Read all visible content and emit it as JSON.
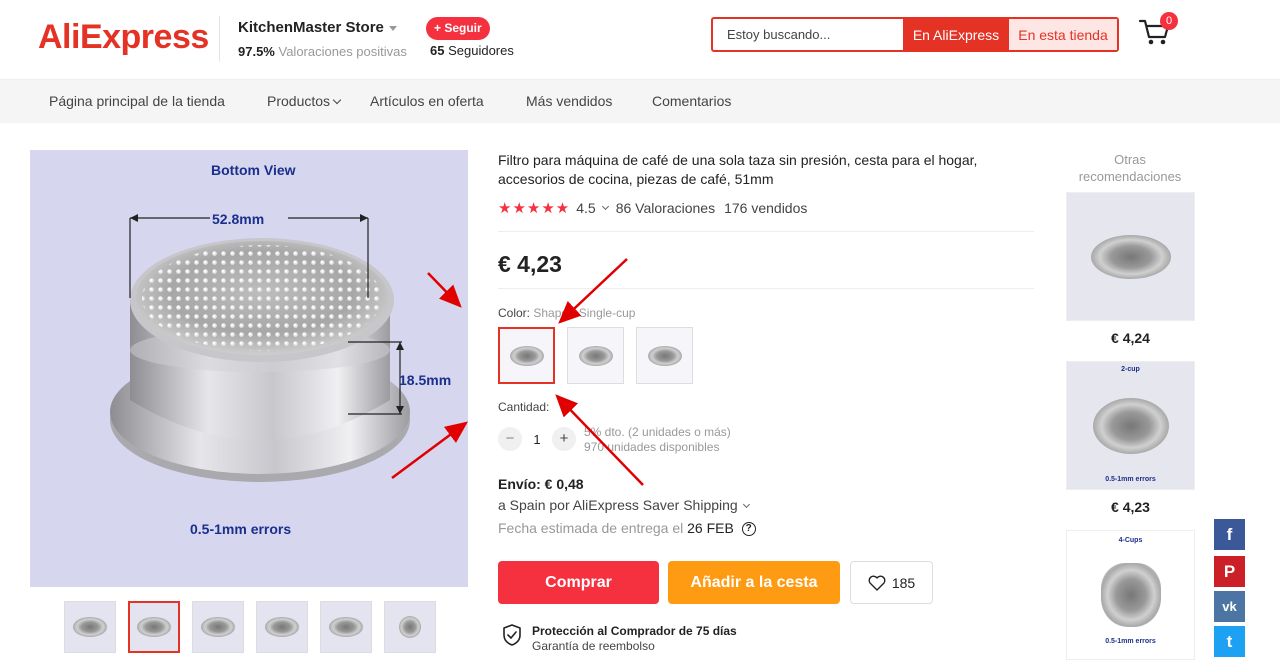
{
  "header": {
    "logo": "AliExpress",
    "store_name": "KitchenMaster Store",
    "rating_pct": "97.5%",
    "rating_label": "Valoraciones positivas",
    "follow_label": "+ Seguir",
    "followers_count": "65",
    "followers_label": "Seguidores",
    "search_placeholder": "Estoy buscando...",
    "search_aliexpress": "En AliExpress",
    "search_store": "En esta tienda",
    "cart_count": "0",
    "accent_color": "#e43225"
  },
  "nav": {
    "items": [
      "Página principal de la tienda",
      "Productos",
      "Artículos en oferta",
      "Más vendidos",
      "Comentarios"
    ]
  },
  "gallery": {
    "main_texts": {
      "view": "Bottom View",
      "diameter": "52.8mm",
      "height": "18.5mm",
      "tolerance": "0.5-1mm errors"
    },
    "thumb_count": 6,
    "active_thumb": 2
  },
  "product": {
    "title": "Filtro para máquina de café de una sola taza sin presión, cesta para el hogar, accesorios de cocina, piezas de café, 51mm",
    "stars": "★★★★★",
    "rating": "4.5",
    "reviews": "86 Valoraciones",
    "sold": "176 vendidos",
    "price": "€ 4,23",
    "color_label": "Color:",
    "color_value": "Shape1-Single-cup",
    "qty_label": "Cantidad:",
    "qty_minus": "−",
    "qty_value": "1",
    "qty_plus": "+",
    "discount": "5% dto. (2 unidades o más)",
    "available": "970 unidades disponibles",
    "shipping": "Envío: € 0,48",
    "ship_method": "a Spain por AliExpress Saver Shipping",
    "delivery_label": "Fecha estimada de entrega el",
    "delivery_date": "26 FEB",
    "buy": "Comprar",
    "add_cart": "Añadir a la cesta",
    "wishlist": "185",
    "protect_title": "Protección al Comprador de 75 días",
    "protect_sub": "Garantía de reembolso"
  },
  "recommend": {
    "title": "Otras recomendaciones",
    "items": [
      {
        "label": "",
        "price": "€ 4,24"
      },
      {
        "label": "2-cup",
        "price": "€ 4,23"
      },
      {
        "label": "4-Cups",
        "price": ""
      }
    ],
    "rec_tolerance": "0.5-1mm errors"
  },
  "social": {
    "facebook": "f",
    "pinterest": "P",
    "vk": "vk",
    "twitter": "t",
    "colors": {
      "facebook": "#3b5998",
      "pinterest": "#cb2027",
      "vk": "#4c75a3",
      "twitter": "#1da1f2"
    }
  }
}
